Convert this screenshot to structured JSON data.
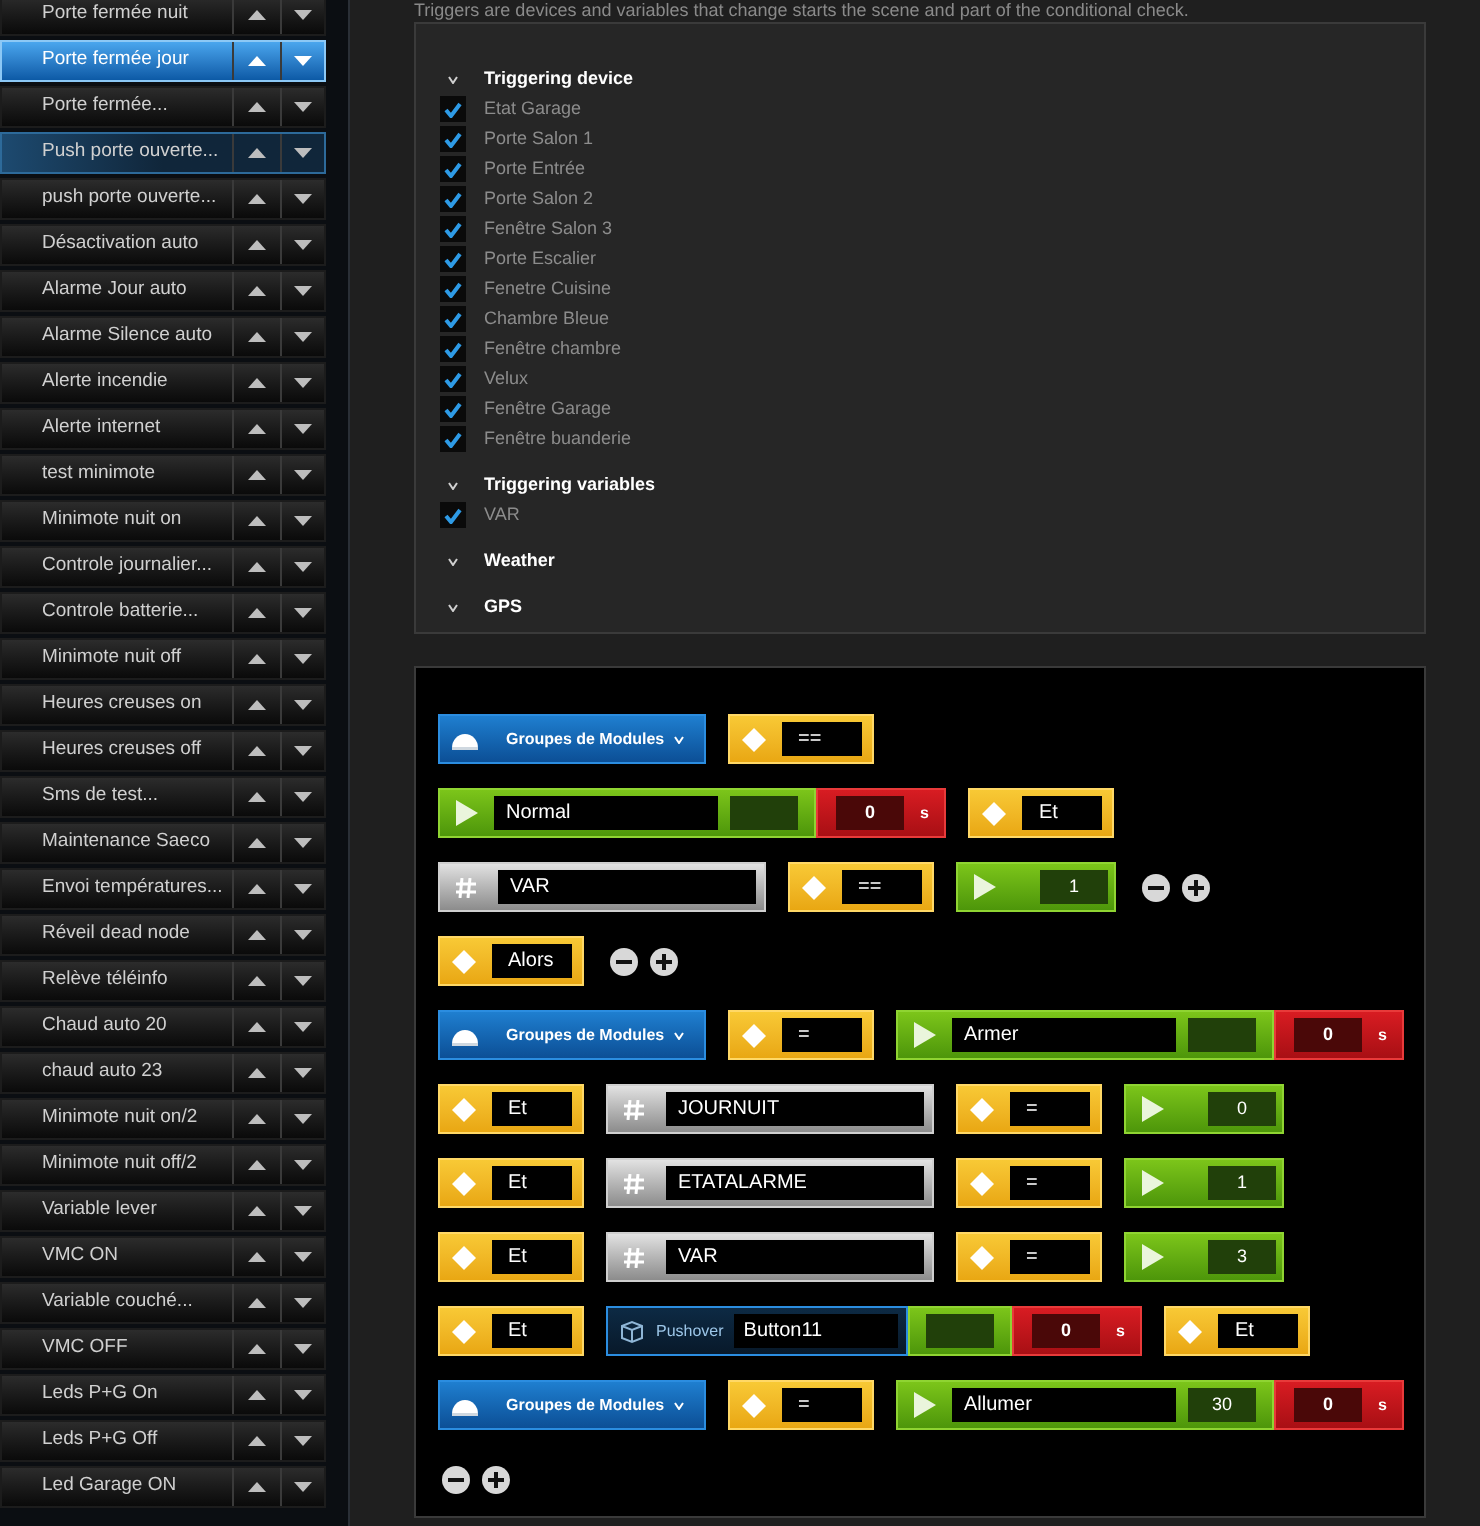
{
  "sidebar": {
    "items": [
      {
        "label": "Porte fermée nuit",
        "selected": false,
        "hovered": false
      },
      {
        "label": "Porte fermée jour",
        "selected": true,
        "hovered": false
      },
      {
        "label": "Porte fermée...",
        "selected": false,
        "hovered": false
      },
      {
        "label": "Push porte ouverte...",
        "selected": false,
        "hovered": true
      },
      {
        "label": "push porte ouverte...",
        "selected": false,
        "hovered": false
      },
      {
        "label": "Désactivation auto",
        "selected": false,
        "hovered": false
      },
      {
        "label": "Alarme Jour auto",
        "selected": false,
        "hovered": false
      },
      {
        "label": "Alarme Silence auto",
        "selected": false,
        "hovered": false
      },
      {
        "label": "Alerte incendie",
        "selected": false,
        "hovered": false
      },
      {
        "label": "Alerte internet",
        "selected": false,
        "hovered": false
      },
      {
        "label": "test minimote",
        "selected": false,
        "hovered": false
      },
      {
        "label": "Minimote nuit on",
        "selected": false,
        "hovered": false
      },
      {
        "label": "Controle journalier...",
        "selected": false,
        "hovered": false
      },
      {
        "label": "Controle batterie...",
        "selected": false,
        "hovered": false
      },
      {
        "label": "Minimote nuit off",
        "selected": false,
        "hovered": false
      },
      {
        "label": "Heures creuses on",
        "selected": false,
        "hovered": false
      },
      {
        "label": "Heures creuses off",
        "selected": false,
        "hovered": false
      },
      {
        "label": "Sms de test...",
        "selected": false,
        "hovered": false
      },
      {
        "label": "Maintenance Saeco",
        "selected": false,
        "hovered": false
      },
      {
        "label": "Envoi températures...",
        "selected": false,
        "hovered": false
      },
      {
        "label": "Réveil dead node",
        "selected": false,
        "hovered": false
      },
      {
        "label": "Relève téléinfo",
        "selected": false,
        "hovered": false
      },
      {
        "label": "Chaud auto 20",
        "selected": false,
        "hovered": false
      },
      {
        "label": "chaud auto 23",
        "selected": false,
        "hovered": false
      },
      {
        "label": "Minimote nuit on/2",
        "selected": false,
        "hovered": false
      },
      {
        "label": "Minimote nuit off/2",
        "selected": false,
        "hovered": false
      },
      {
        "label": "Variable lever",
        "selected": false,
        "hovered": false
      },
      {
        "label": "VMC ON",
        "selected": false,
        "hovered": false
      },
      {
        "label": "Variable couché...",
        "selected": false,
        "hovered": false
      },
      {
        "label": "VMC OFF",
        "selected": false,
        "hovered": false
      },
      {
        "label": "Leds P+G On",
        "selected": false,
        "hovered": false
      },
      {
        "label": "Leds P+G Off",
        "selected": false,
        "hovered": false
      },
      {
        "label": "Led Garage ON",
        "selected": false,
        "hovered": false
      }
    ]
  },
  "triggers": {
    "description": "Triggers are devices and variables that change starts the scene and part of the conditional check.",
    "sections": [
      {
        "title": "Triggering device",
        "items": [
          {
            "label": "Etat Garage",
            "checked": true
          },
          {
            "label": "Porte Salon 1",
            "checked": true
          },
          {
            "label": "Porte Entrée",
            "checked": true
          },
          {
            "label": "Porte Salon 2",
            "checked": true
          },
          {
            "label": "Fenêtre Salon 3",
            "checked": true
          },
          {
            "label": "Porte Escalier",
            "checked": true
          },
          {
            "label": "Fenetre Cuisine",
            "checked": true
          },
          {
            "label": "Chambre Bleue",
            "checked": true
          },
          {
            "label": "Fenêtre chambre",
            "checked": true
          },
          {
            "label": "Velux",
            "checked": true
          },
          {
            "label": "Fenêtre Garage",
            "checked": true
          },
          {
            "label": "Fenêtre buanderie",
            "checked": true
          }
        ]
      },
      {
        "title": "Triggering variables",
        "items": [
          {
            "label": "VAR",
            "checked": true
          }
        ]
      },
      {
        "title": "Weather"
      },
      {
        "title": "GPS"
      }
    ]
  },
  "blocks": {
    "rows": [
      [
        {
          "kind": "device",
          "label": "Groupes de Modules"
        },
        {
          "kind": "operator",
          "value": "=="
        }
      ],
      [
        {
          "kind": "action",
          "name": "Normal",
          "delay": "0",
          "unit": "s"
        },
        {
          "kind": "operator",
          "value": "Et"
        }
      ],
      [
        {
          "kind": "variable",
          "name": "VAR"
        },
        {
          "kind": "operator",
          "value": "=="
        },
        {
          "kind": "value",
          "value": "1"
        },
        {
          "kind": "controls"
        }
      ],
      [
        {
          "kind": "operator",
          "value": "Alors"
        },
        {
          "kind": "controls"
        }
      ],
      [
        {
          "kind": "device",
          "label": "Groupes de Modules"
        },
        {
          "kind": "operator",
          "value": "="
        },
        {
          "kind": "action",
          "name": "Armer",
          "delay": "0",
          "unit": "s"
        }
      ],
      [
        {
          "kind": "operator",
          "value": "Et"
        },
        {
          "kind": "variable",
          "name": "JOURNUIT"
        },
        {
          "kind": "operator",
          "value": "="
        },
        {
          "kind": "value",
          "value": "0"
        }
      ],
      [
        {
          "kind": "operator",
          "value": "Et"
        },
        {
          "kind": "variable",
          "name": "ETATALARME"
        },
        {
          "kind": "operator",
          "value": "="
        },
        {
          "kind": "value",
          "value": "1"
        }
      ],
      [
        {
          "kind": "operator",
          "value": "Et"
        },
        {
          "kind": "variable",
          "name": "VAR"
        },
        {
          "kind": "operator",
          "value": "="
        },
        {
          "kind": "value",
          "value": "3"
        }
      ],
      [
        {
          "kind": "operator",
          "value": "Et"
        },
        {
          "kind": "pushover",
          "label": "Pushover",
          "value": "Button11",
          "delay": "0",
          "unit": "s"
        },
        {
          "kind": "operator",
          "value": "Et"
        }
      ],
      [
        {
          "kind": "device",
          "label": "Groupes de Modules"
        },
        {
          "kind": "operator",
          "value": "="
        },
        {
          "kind": "action",
          "name": "Allumer",
          "value": "30",
          "delay": "0",
          "unit": "s"
        }
      ],
      [
        {
          "kind": "controls"
        }
      ]
    ]
  }
}
